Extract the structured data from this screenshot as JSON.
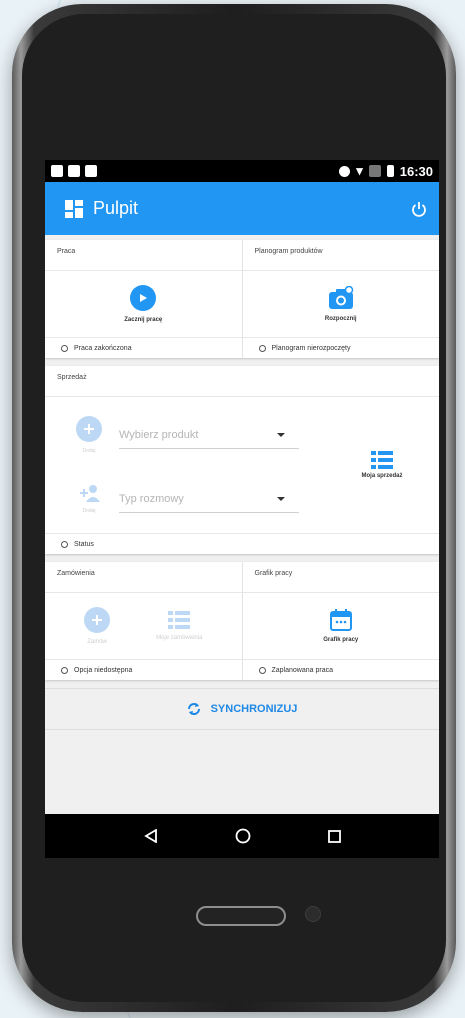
{
  "status_bar": {
    "time": "16:30"
  },
  "app_bar": {
    "title": "Pulpit",
    "icon": "dashboard-icon",
    "action_icon": "power-icon"
  },
  "sections": {
    "work": {
      "header": "Praca",
      "action_label": "Zacznij pracę",
      "status": "Praca zakończona"
    },
    "planogram": {
      "header": "Planogram produktów",
      "action_label": "Rozpocznij",
      "status": "Planogram nierozpoczęty"
    },
    "sales": {
      "header": "Sprzedaż",
      "add_label": "Dodaj",
      "product_placeholder": "Wybierz produkt",
      "add_person_label": "Dodaj",
      "conversation_placeholder": "Typ rozmowy",
      "my_sales_label": "Moja sprzedaż",
      "status": "Status"
    },
    "orders": {
      "header": "Zamówienia",
      "order_label": "Zamów",
      "my_orders_label": "Moje zamówienia",
      "status": "Opcja niedostępna"
    },
    "schedule": {
      "header": "Grafik pracy",
      "action_label": "Grafik pracy",
      "status": "Zaplanowana praca"
    }
  },
  "sync": {
    "label": "SYNCHRONIZUJ"
  },
  "colors": {
    "primary": "#2196f3",
    "disabled": "#bcd8f5"
  }
}
